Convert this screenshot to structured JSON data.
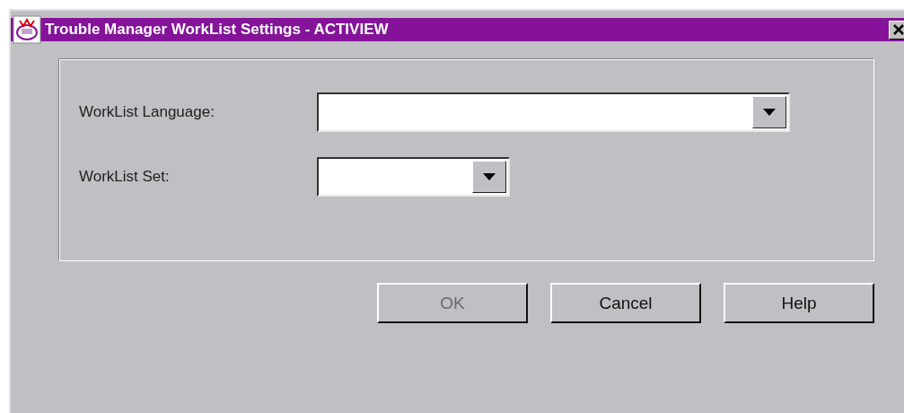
{
  "window": {
    "title": "Trouble Manager WorkList Settings - ACTIVIEW"
  },
  "fields": [
    {
      "label": "WorkList Language:",
      "kind": "wide"
    },
    {
      "label": "WorkList Set:",
      "kind": "narrow"
    }
  ],
  "buttons": [
    {
      "label": "OK",
      "disabled": true
    },
    {
      "label": "Cancel",
      "disabled": false
    },
    {
      "label": "Help",
      "disabled": false
    }
  ]
}
